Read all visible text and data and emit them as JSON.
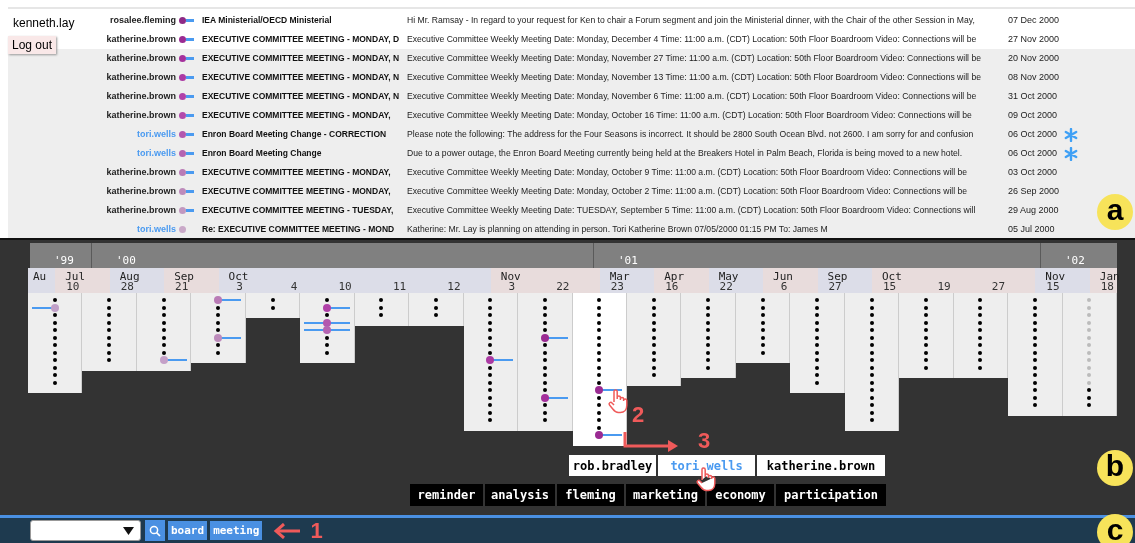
{
  "user": {
    "name": "kenneth.lay",
    "logout": "Log out"
  },
  "emails": [
    {
      "sender": "rosalee.fleming",
      "highlighted": false,
      "color": "#8e2a86",
      "linked": true,
      "subject": "IEA Ministerial/OECD Ministerial",
      "body": "Hi Mr. Ramsay - In regard to your request for Ken to chair a Forum segment and join the Ministerial dinner, with the Chair of the other Session in May,",
      "date": "07 Dec 2000",
      "starred": false,
      "shaded": false
    },
    {
      "sender": "katherine.brown",
      "highlighted": false,
      "color": "#9a2b92",
      "linked": true,
      "subject": "EXECUTIVE COMMITTEE MEETING - MONDAY, D",
      "body": "Executive Committee Weekly Meeting Date: Monday, December 4 Time: 11:00 a.m. (CDT) Location: 50th Floor Boardroom Video: Connections will be",
      "date": "27 Nov 2000",
      "starred": false,
      "shaded": false
    },
    {
      "sender": "katherine.brown",
      "highlighted": false,
      "color": "#a4309c",
      "linked": true,
      "subject": "EXECUTIVE COMMITTEE MEETING - MONDAY, N",
      "body": "Executive Committee Weekly Meeting Date: Monday, November 27 Time: 11:00 a.m. (CDT) Location: 50th Floor Boardroom Video: Connections will be",
      "date": "20 Nov 2000",
      "starred": false,
      "shaded": true
    },
    {
      "sender": "katherine.brown",
      "highlighted": false,
      "color": "#ab3aa3",
      "linked": true,
      "subject": "EXECUTIVE COMMITTEE MEETING - MONDAY, N",
      "body": "Executive Committee Weekly Meeting Date: Monday, November 13 Time: 11:00 a.m. (CDT) Location: 50th Floor Boardroom Video: Connections will be",
      "date": "08 Nov 2000",
      "starred": false,
      "shaded": true
    },
    {
      "sender": "katherine.brown",
      "highlighted": false,
      "color": "#b041a8",
      "linked": true,
      "subject": "EXECUTIVE COMMITTEE MEETING - MONDAY, N",
      "body": "Executive Committee Weekly Meeting Date: Monday, November 6 Time: 11:00 a.m. (CDT) Location: 50th Floor Boardroom Video: Connections will be",
      "date": "31 Oct 2000",
      "starred": false,
      "shaded": true
    },
    {
      "sender": "katherine.brown",
      "highlighted": false,
      "color": "#b24aab",
      "linked": true,
      "subject": "EXECUTIVE COMMITTEE MEETING - MONDAY,",
      "body": "Executive Committee Weekly Meeting Date: Monday, October 16 Time: 11:00 a.m. (CDT) Location: 50th Floor Boardroom Video: Connections will be",
      "date": "09 Oct 2000",
      "starred": false,
      "shaded": true
    },
    {
      "sender": "tori.wells",
      "highlighted": true,
      "color": "#b257ae",
      "linked": true,
      "subject": "Enron Board Meeting Change - CORRECTION",
      "body": "Please note the following: The address for the Four Seasons is incorrect. It should be 2800 South Ocean Blvd. not 2600. I am sorry for and confusion",
      "date": "06 Oct 2000",
      "starred": true,
      "shaded": true
    },
    {
      "sender": "tori.wells",
      "highlighted": true,
      "color": "#b464b1",
      "linked": true,
      "subject": "Enron Board Meeting Change",
      "body": "Due to a power outage, the Enron Board Meeting currently being held at the Breakers Hotel in Palm Beach, Florida is being moved to a new hotel.",
      "date": "06 Oct 2000",
      "starred": true,
      "shaded": true
    },
    {
      "sender": "katherine.brown",
      "highlighted": false,
      "color": "#b97bb6",
      "linked": true,
      "subject": "EXECUTIVE COMMITTEE MEETING - MONDAY,",
      "body": "Executive Committee Weekly Meeting Date: Monday, October 9 Time: 11:00 a.m. (CDT) Location: 50th Floor Boardroom Video: Connections will be",
      "date": "03 Oct 2000",
      "starred": false,
      "shaded": true
    },
    {
      "sender": "katherine.brown",
      "highlighted": false,
      "color": "#bd8bbb",
      "linked": true,
      "subject": "EXECUTIVE COMMITTEE MEETING - MONDAY,",
      "body": "Executive Committee Weekly Meeting Date: Monday, October 2 Time: 11:00 a.m. (CDT) Location: 50th Floor Boardroom Video: Connections will be",
      "date": "26 Sep 2000",
      "starred": false,
      "shaded": true
    },
    {
      "sender": "katherine.brown",
      "highlighted": false,
      "color": "#c198c0",
      "linked": true,
      "subject": "EXECUTIVE COMMITTEE MEETING - TUESDAY,",
      "body": "Executive Committee Weekly Meeting Date: TUESDAY, September 5 Time: 11:00 a.m. (CDT) Location: 50th Floor Boardroom Video: Connections will",
      "date": "29 Aug 2000",
      "starred": false,
      "shaded": true
    },
    {
      "sender": "tori.wells",
      "highlighted": true,
      "color": "#c9a9c8",
      "linked": false,
      "subject": "Re: EXECUTIVE COMMITTEE MEETING - MOND",
      "body": "Katherine: Mr. Lay is planning on attending in person. Tori Katherine Brown 07/05/2000 01:15 PM To: James M",
      "date": "05 Jul 2000",
      "starred": false,
      "shaded": true
    }
  ],
  "timeline": {
    "years": [
      "'99",
      "'00",
      "'01",
      "'02"
    ],
    "leading_month": "Au",
    "columns": [
      {
        "month": "Jul",
        "day": "10",
        "selected": false,
        "marks": [
          {
            "kind": "dot"
          },
          {
            "kind": "message",
            "color": "#c0a0c8",
            "link_left": true,
            "link_right": false
          },
          {
            "kind": "dot"
          },
          {
            "kind": "dot"
          },
          {
            "kind": "dot"
          },
          {
            "kind": "dot"
          },
          {
            "kind": "dot"
          },
          {
            "kind": "dot"
          },
          {
            "kind": "dot"
          },
          {
            "kind": "dot"
          },
          {
            "kind": "dot"
          },
          {
            "kind": "dot"
          }
        ]
      },
      {
        "month": "Aug",
        "day": "28",
        "selected": false,
        "marks": [
          {
            "kind": "dot"
          },
          {
            "kind": "dot"
          },
          {
            "kind": "dot"
          },
          {
            "kind": "dot"
          },
          {
            "kind": "dot"
          },
          {
            "kind": "dot"
          },
          {
            "kind": "dot"
          },
          {
            "kind": "dot"
          },
          {
            "kind": "dot"
          }
        ]
      },
      {
        "month": "Sep",
        "day": "21",
        "selected": false,
        "marks": [
          {
            "kind": "dot"
          },
          {
            "kind": "dot"
          },
          {
            "kind": "dot"
          },
          {
            "kind": "dot"
          },
          {
            "kind": "dot"
          },
          {
            "kind": "dot"
          },
          {
            "kind": "dot"
          },
          {
            "kind": "dot"
          },
          {
            "kind": "message",
            "color": "#c4a0c8",
            "link_left": false,
            "link_right": true
          }
        ]
      },
      {
        "month": "Oct",
        "day": "3",
        "selected": false,
        "marks": [
          {
            "kind": "message",
            "color": "#b97bb6",
            "link_left": false,
            "link_right": true
          },
          {
            "kind": "dot"
          },
          {
            "kind": "dot"
          },
          {
            "kind": "dot"
          },
          {
            "kind": "dot"
          },
          {
            "kind": "message",
            "color": "#bd8bbb",
            "link_left": false,
            "link_right": true
          },
          {
            "kind": "dot"
          },
          {
            "kind": "dot"
          }
        ]
      },
      {
        "day": "4",
        "selected": false,
        "marks": [
          {
            "kind": "dot"
          },
          {
            "kind": "dot"
          }
        ]
      },
      {
        "day": "10",
        "selected": false,
        "marks": [
          {
            "kind": "dot"
          },
          {
            "kind": "message",
            "color": "#b041a8",
            "link_left": false,
            "link_right": true
          },
          {
            "kind": "dot"
          },
          {
            "kind": "message",
            "color": "#b257ae",
            "link_left": true,
            "link_right": true
          },
          {
            "kind": "message",
            "color": "#b464b1",
            "link_left": true,
            "link_right": true
          },
          {
            "kind": "dot"
          },
          {
            "kind": "dot"
          },
          {
            "kind": "dot"
          }
        ]
      },
      {
        "day": "11",
        "selected": false,
        "marks": [
          {
            "kind": "dot"
          },
          {
            "kind": "dot"
          },
          {
            "kind": "dot"
          }
        ]
      },
      {
        "day": "12",
        "selected": false,
        "marks": [
          {
            "kind": "dot"
          },
          {
            "kind": "dot"
          },
          {
            "kind": "dot"
          }
        ]
      },
      {
        "month": "Nov",
        "day": "3",
        "selected": false,
        "marks": [
          {
            "kind": "dot"
          },
          {
            "kind": "dot"
          },
          {
            "kind": "dot"
          },
          {
            "kind": "dot"
          },
          {
            "kind": "dot"
          },
          {
            "kind": "dot"
          },
          {
            "kind": "dot"
          },
          {
            "kind": "dot"
          },
          {
            "kind": "message",
            "color": "#ab3aa3",
            "link_left": false,
            "link_right": true
          },
          {
            "kind": "dot"
          },
          {
            "kind": "dot"
          },
          {
            "kind": "dot"
          },
          {
            "kind": "dot"
          },
          {
            "kind": "dot"
          },
          {
            "kind": "dot"
          },
          {
            "kind": "dot"
          },
          {
            "kind": "dot"
          }
        ]
      },
      {
        "day": "22",
        "selected": false,
        "marks": [
          {
            "kind": "dot"
          },
          {
            "kind": "dot"
          },
          {
            "kind": "dot"
          },
          {
            "kind": "dot"
          },
          {
            "kind": "dot"
          },
          {
            "kind": "message",
            "color": "#9a2b92",
            "link_left": false,
            "link_right": true
          },
          {
            "kind": "dot"
          },
          {
            "kind": "dot"
          },
          {
            "kind": "dot"
          },
          {
            "kind": "dot"
          },
          {
            "kind": "dot"
          },
          {
            "kind": "dot"
          },
          {
            "kind": "dot"
          },
          {
            "kind": "message",
            "color": "#a4309c",
            "link_left": false,
            "link_right": true
          },
          {
            "kind": "dot"
          },
          {
            "kind": "dot"
          },
          {
            "kind": "dot"
          }
        ]
      },
      {
        "month": "Mar",
        "day": "23",
        "selected": true,
        "marks": [
          {
            "kind": "dot"
          },
          {
            "kind": "dot"
          },
          {
            "kind": "dot"
          },
          {
            "kind": "dot"
          },
          {
            "kind": "dot"
          },
          {
            "kind": "dot"
          },
          {
            "kind": "dot"
          },
          {
            "kind": "dot"
          },
          {
            "kind": "dot"
          },
          {
            "kind": "dot"
          },
          {
            "kind": "dot"
          },
          {
            "kind": "dot"
          },
          {
            "kind": "message",
            "color": "#9a2b92",
            "link_left": false,
            "link_right": true
          },
          {
            "kind": "dot"
          },
          {
            "kind": "dot"
          },
          {
            "kind": "dot"
          },
          {
            "kind": "dot"
          },
          {
            "kind": "dot"
          },
          {
            "kind": "message",
            "color": "#9a2b92",
            "link_left": false,
            "link_right": true
          }
        ]
      },
      {
        "month": "Apr",
        "day": "16",
        "selected": false,
        "marks": [
          {
            "kind": "dot"
          },
          {
            "kind": "dot"
          },
          {
            "kind": "dot"
          },
          {
            "kind": "dot"
          },
          {
            "kind": "dot"
          },
          {
            "kind": "dot"
          },
          {
            "kind": "dot"
          },
          {
            "kind": "dot"
          },
          {
            "kind": "dot"
          },
          {
            "kind": "dot"
          },
          {
            "kind": "dot"
          }
        ]
      },
      {
        "month": "May",
        "day": "22",
        "selected": false,
        "marks": [
          {
            "kind": "dot"
          },
          {
            "kind": "dot"
          },
          {
            "kind": "dot"
          },
          {
            "kind": "dot"
          },
          {
            "kind": "dot"
          },
          {
            "kind": "dot"
          },
          {
            "kind": "dot"
          },
          {
            "kind": "dot"
          },
          {
            "kind": "dot"
          },
          {
            "kind": "dot"
          }
        ]
      },
      {
        "month": "Jun",
        "day": "6",
        "selected": false,
        "marks": [
          {
            "kind": "dot"
          },
          {
            "kind": "dot"
          },
          {
            "kind": "dot"
          },
          {
            "kind": "dot"
          },
          {
            "kind": "dot"
          },
          {
            "kind": "dot"
          },
          {
            "kind": "dot"
          },
          {
            "kind": "dot"
          }
        ]
      },
      {
        "month": "Sep",
        "day": "27",
        "selected": false,
        "marks": [
          {
            "kind": "dot"
          },
          {
            "kind": "dot"
          },
          {
            "kind": "dot"
          },
          {
            "kind": "dot"
          },
          {
            "kind": "dot"
          },
          {
            "kind": "dot"
          },
          {
            "kind": "dot"
          },
          {
            "kind": "dot"
          },
          {
            "kind": "dot"
          },
          {
            "kind": "dot"
          },
          {
            "kind": "dot"
          },
          {
            "kind": "dot"
          }
        ]
      },
      {
        "month": "Oct",
        "day": "15",
        "selected": false,
        "marks": [
          {
            "kind": "dot"
          },
          {
            "kind": "dot"
          },
          {
            "kind": "dot"
          },
          {
            "kind": "dot"
          },
          {
            "kind": "dot"
          },
          {
            "kind": "dot"
          },
          {
            "kind": "dot"
          },
          {
            "kind": "dot"
          },
          {
            "kind": "dot"
          },
          {
            "kind": "dot"
          },
          {
            "kind": "dot"
          },
          {
            "kind": "dot"
          },
          {
            "kind": "dot"
          },
          {
            "kind": "dot"
          },
          {
            "kind": "dot"
          },
          {
            "kind": "dot"
          },
          {
            "kind": "dot"
          }
        ]
      },
      {
        "day": "19",
        "selected": false,
        "marks": [
          {
            "kind": "dot"
          },
          {
            "kind": "dot"
          },
          {
            "kind": "dot"
          },
          {
            "kind": "dot"
          },
          {
            "kind": "dot"
          },
          {
            "kind": "dot"
          },
          {
            "kind": "dot"
          },
          {
            "kind": "dot"
          },
          {
            "kind": "dot"
          },
          {
            "kind": "dot"
          }
        ]
      },
      {
        "day": "27",
        "selected": false,
        "marks": [
          {
            "kind": "dot"
          },
          {
            "kind": "dot"
          },
          {
            "kind": "dot"
          },
          {
            "kind": "dot"
          },
          {
            "kind": "dot"
          },
          {
            "kind": "dot"
          },
          {
            "kind": "dot"
          },
          {
            "kind": "dot"
          },
          {
            "kind": "dot"
          },
          {
            "kind": "dot"
          }
        ]
      },
      {
        "month": "Nov",
        "day": "15",
        "selected": false,
        "marks": [
          {
            "kind": "dot"
          },
          {
            "kind": "dot"
          },
          {
            "kind": "dot"
          },
          {
            "kind": "dot"
          },
          {
            "kind": "dot"
          },
          {
            "kind": "dot"
          },
          {
            "kind": "dot"
          },
          {
            "kind": "dot"
          },
          {
            "kind": "dot"
          },
          {
            "kind": "dot"
          },
          {
            "kind": "dot"
          },
          {
            "kind": "dot"
          },
          {
            "kind": "dot"
          },
          {
            "kind": "dot"
          },
          {
            "kind": "dot"
          }
        ]
      },
      {
        "month": "Jan",
        "day": "18",
        "selected": false,
        "marks": [
          {
            "kind": "ghost"
          },
          {
            "kind": "ghost"
          },
          {
            "kind": "ghost"
          },
          {
            "kind": "ghost"
          },
          {
            "kind": "ghost"
          },
          {
            "kind": "ghost"
          },
          {
            "kind": "ghost"
          },
          {
            "kind": "ghost"
          },
          {
            "kind": "ghost"
          },
          {
            "kind": "ghost"
          },
          {
            "kind": "ghost"
          },
          {
            "kind": "ghost"
          },
          {
            "kind": "dot"
          },
          {
            "kind": "dot"
          },
          {
            "kind": "dot"
          }
        ]
      }
    ]
  },
  "people": [
    {
      "name": "rob.bradley",
      "selected": false
    },
    {
      "name": "tori.wells",
      "selected": true
    },
    {
      "name": "katherine.brown",
      "selected": false
    }
  ],
  "keywords": [
    "reminder",
    "analysis",
    "fleming",
    "marketing",
    "economy",
    "participation"
  ],
  "search": {
    "tags": [
      "board",
      "meeting"
    ]
  },
  "callouts": {
    "steps": [
      "1",
      "2",
      "3"
    ],
    "panels": [
      "a",
      "b",
      "c"
    ]
  }
}
